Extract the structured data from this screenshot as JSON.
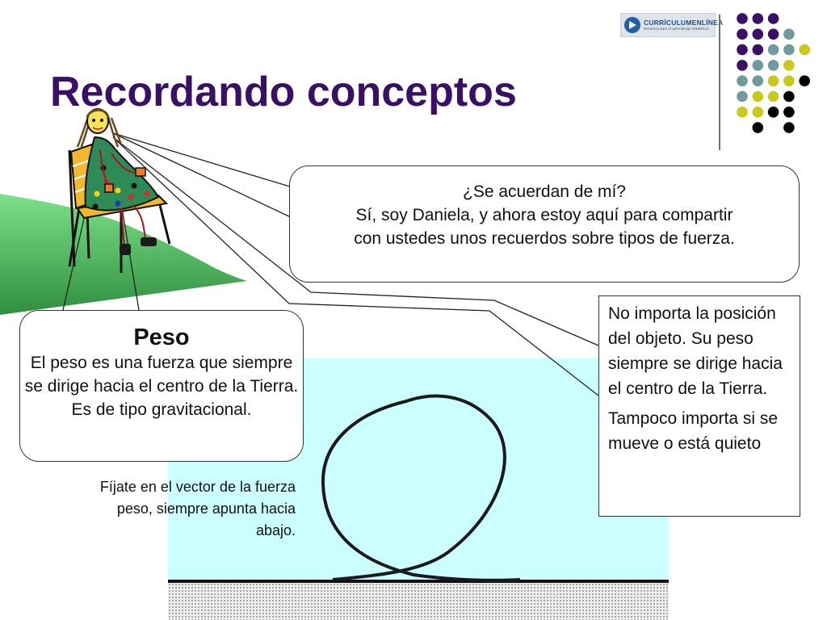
{
  "slide": {
    "title": "Recordando conceptos",
    "logo": {
      "name": "CURRÍCULUMENLÍNEA",
      "tagline": "Recursos para el aprendizaje MINEDUC"
    },
    "speech_bubble": {
      "line1": "¿Se acuerdan de mí?",
      "line2": "Sí, soy Daniela, y ahora estoy aquí para compartir",
      "line3": "con ustedes  unos recuerdos sobre tipos de fuerza."
    },
    "peso_bubble": {
      "heading": "Peso",
      "body": "El peso es una fuerza que siempre se dirige hacia el centro de la Tierra. Es de tipo gravitacional."
    },
    "right_box": {
      "paragraph1": "No importa la posición del objeto. Su peso siempre se dirige hacia el centro de la Tierra.",
      "paragraph2": "Tampoco importa si se mueve o está quieto"
    },
    "note": "Fíjate en el vector de la fuerza peso, siempre apunta hacia abajo."
  },
  "colors": {
    "title": "#3a0f66",
    "dot_purple": "#3a0f66",
    "dot_teal": "#6e9c9c",
    "dot_yellow": "#c8c81e",
    "dot_black": "#000000",
    "water": "#ccffff",
    "grass": "#4caf50",
    "dress": "#2e8b57"
  },
  "decor": {
    "dot_grid": [
      [
        "purple",
        "purple",
        "purple",
        null,
        null
      ],
      [
        "purple",
        "purple",
        "purple",
        "teal",
        null
      ],
      [
        "purple",
        "purple",
        "teal",
        "teal",
        "yellow"
      ],
      [
        "purple",
        "teal",
        "teal",
        "yellow",
        null
      ],
      [
        "teal",
        "teal",
        "yellow",
        "yellow",
        "black"
      ],
      [
        "teal",
        "yellow",
        "yellow",
        "black",
        null
      ],
      [
        "yellow",
        "yellow",
        "black",
        "black",
        null
      ],
      [
        null,
        "black",
        null,
        "black",
        null
      ]
    ],
    "icons": [
      "curriculum-logo-icon",
      "girl-on-chair-illustration",
      "loop-track-illustration"
    ]
  }
}
